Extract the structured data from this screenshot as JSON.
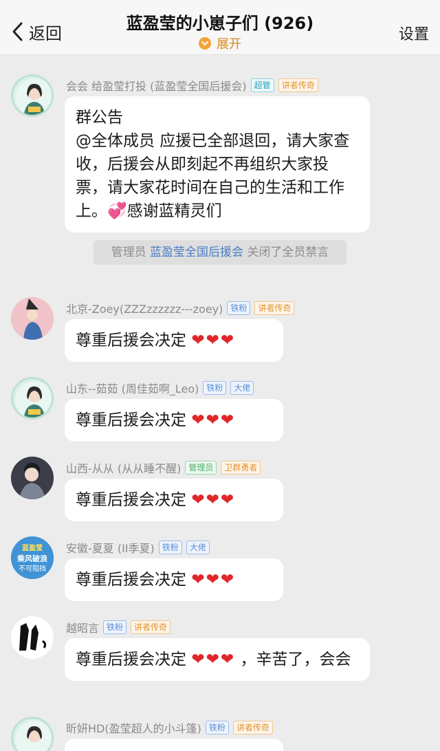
{
  "header": {
    "back_label": "返回",
    "title": "蓝盈莹的小崽子们 (926)",
    "expand_label": "展开",
    "settings_label": "设置"
  },
  "messages": [
    {
      "sender": "会会 给盈莹打投 (蓝盈莹全国后援会)",
      "badges": [
        "超管",
        "讲者传奇"
      ],
      "text": "群公告\n@全体成员 应援已全部退回，请大家查收，后援会从即刻起不再组织大家投票，请大家花时间在自己的生活和工作上。💞感谢蓝精灵们"
    },
    {
      "sender": "北京-Zoey(ZZZzzzzzz---zoey)",
      "badges": [
        "铁粉",
        "讲者传奇"
      ],
      "text": "尊重后援会决定",
      "hearts": "❤❤❤"
    },
    {
      "sender": "山东--茹茹 (周佳茹啊_Leo)",
      "badges": [
        "铁粉",
        "大佬"
      ],
      "text": "尊重后援会决定",
      "hearts": "❤❤❤"
    },
    {
      "sender": "山西-从从 (从从睡不醒)",
      "badges": [
        "管理员",
        "卫群勇者"
      ],
      "text": "尊重后援会决定",
      "hearts": "❤❤❤"
    },
    {
      "sender": "安徽-夏夏 (II季夏)",
      "badges": [
        "铁粉",
        "大佬"
      ],
      "text": "尊重后援会决定",
      "hearts": "❤❤❤"
    },
    {
      "sender": "越昭言",
      "badges": [
        "铁粉",
        "讲者传奇"
      ],
      "text": "尊重后援会决定",
      "hearts": "❤❤❤",
      "tail": "，辛苦了，会会"
    },
    {
      "sender": "昕妍HD(盈莹超人的小斗篷)",
      "badges": [
        "铁粉",
        "讲者传奇"
      ]
    }
  ],
  "system_notice": {
    "prefix": "管理员",
    "link": "蓝盈莹全国后援会",
    "suffix": "关闭了全员禁言"
  },
  "avatar_texts": {
    "anhui_line1": "蓝盈莹",
    "anhui_line2": "乘风破浪",
    "anhui_line3": "不可阻挡"
  }
}
